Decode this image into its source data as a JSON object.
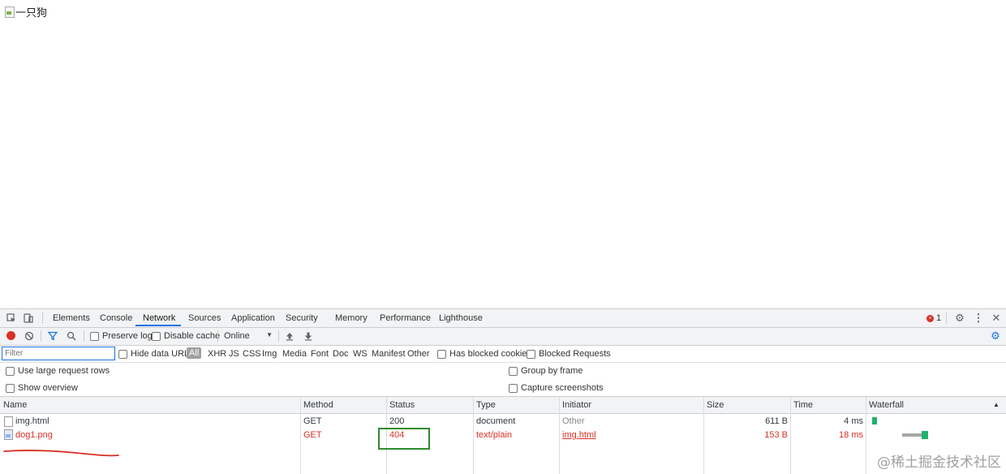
{
  "page": {
    "image_alt": "一只狗"
  },
  "devtools": {
    "tabs": [
      "Elements",
      "Console",
      "Network",
      "Sources",
      "Application",
      "Security",
      "Memory",
      "Performance",
      "Lighthouse"
    ],
    "active_tab": "Network",
    "error_count": "1",
    "toolbar": {
      "preserve_log": "Preserve log",
      "disable_cache": "Disable cache",
      "throttling": "Online"
    },
    "filter": {
      "placeholder": "Filter",
      "hide_data_urls": "Hide data URLs",
      "types": [
        "All",
        "XHR",
        "JS",
        "CSS",
        "Img",
        "Media",
        "Font",
        "Doc",
        "WS",
        "Manifest",
        "Other"
      ],
      "has_blocked_cookies": "Has blocked cookies",
      "blocked_requests": "Blocked Requests"
    },
    "settings": {
      "large_rows": "Use large request rows",
      "group_by_frame": "Group by frame",
      "show_overview": "Show overview",
      "capture_screenshots": "Capture screenshots"
    },
    "columns": {
      "name": "Name",
      "method": "Method",
      "status": "Status",
      "type": "Type",
      "initiator": "Initiator",
      "size": "Size",
      "time": "Time",
      "waterfall": "Waterfall"
    },
    "requests": [
      {
        "name": "img.html",
        "method": "GET",
        "status": "200",
        "type": "document",
        "initiator": "Other",
        "size": "611 B",
        "time": "4 ms"
      },
      {
        "name": "dog1.png",
        "method": "GET",
        "status": "404",
        "type": "text/plain",
        "initiator": "img.html",
        "size": "153 B",
        "time": "18 ms"
      }
    ]
  },
  "watermark": "@稀土掘金技术社区",
  "colors": {
    "accent": "#1a73e8",
    "error": "#d93025",
    "annotation_box": "#2e8b2e",
    "waterfall_bar": "#1fb26b"
  }
}
